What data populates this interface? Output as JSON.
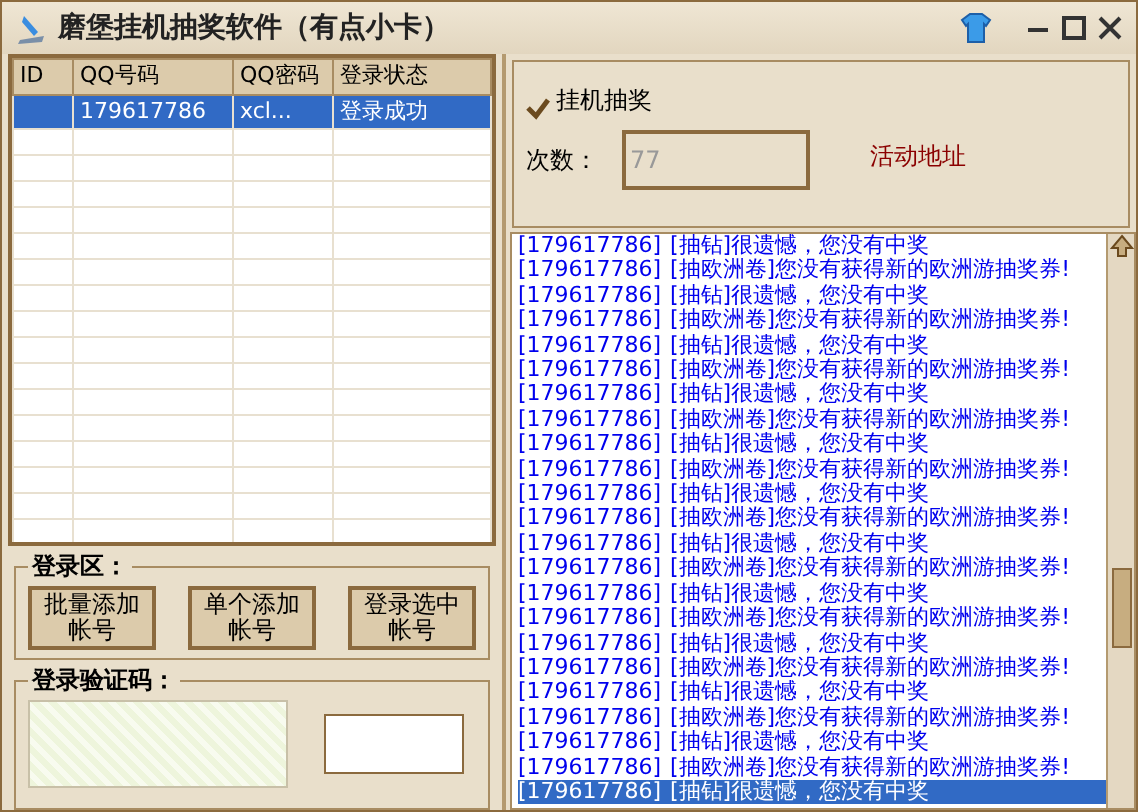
{
  "window": {
    "title": "磨堡挂机抽奖软件（有点小卡）"
  },
  "accounts": {
    "columns": [
      "ID",
      "QQ号码",
      "QQ密码",
      "登录状态"
    ],
    "rows": [
      {
        "qq": "179617786",
        "password": "xcl...",
        "status": "登录成功",
        "selected": true
      }
    ]
  },
  "login_area": {
    "title": "登录区：",
    "buttons": [
      "批量添加帐号",
      "单个添加帐号",
      "登录选中帐号"
    ]
  },
  "captcha": {
    "title": "登录验证码："
  },
  "auto_draw": {
    "label": "挂机抽奖",
    "checked": true
  },
  "count": {
    "label": "次数：",
    "value": "77",
    "disabled": true
  },
  "activity_link": "活动地址",
  "log": [
    {
      "account": "[179617786]",
      "message": "[抽钻]很遗憾，您没有中奖",
      "selected": false
    },
    {
      "account": "[179617786]",
      "message": "[抽欧洲卷]您没有获得新的欧洲游抽奖券!",
      "selected": false
    },
    {
      "account": "[179617786]",
      "message": "[抽钻]很遗憾，您没有中奖",
      "selected": false
    },
    {
      "account": "[179617786]",
      "message": "[抽欧洲卷]您没有获得新的欧洲游抽奖券!",
      "selected": false
    },
    {
      "account": "[179617786]",
      "message": "[抽钻]很遗憾，您没有中奖",
      "selected": false
    },
    {
      "account": "[179617786]",
      "message": "[抽欧洲卷]您没有获得新的欧洲游抽奖券!",
      "selected": false
    },
    {
      "account": "[179617786]",
      "message": "[抽钻]很遗憾，您没有中奖",
      "selected": false
    },
    {
      "account": "[179617786]",
      "message": "[抽欧洲卷]您没有获得新的欧洲游抽奖券!",
      "selected": false
    },
    {
      "account": "[179617786]",
      "message": "[抽钻]很遗憾，您没有中奖",
      "selected": false
    },
    {
      "account": "[179617786]",
      "message": "[抽欧洲卷]您没有获得新的欧洲游抽奖券!",
      "selected": false
    },
    {
      "account": "[179617786]",
      "message": "[抽钻]很遗憾，您没有中奖",
      "selected": false
    },
    {
      "account": "[179617786]",
      "message": "[抽欧洲卷]您没有获得新的欧洲游抽奖券!",
      "selected": false
    },
    {
      "account": "[179617786]",
      "message": "[抽钻]很遗憾，您没有中奖",
      "selected": false
    },
    {
      "account": "[179617786]",
      "message": "[抽欧洲卷]您没有获得新的欧洲游抽奖券!",
      "selected": false
    },
    {
      "account": "[179617786]",
      "message": "[抽钻]很遗憾，您没有中奖",
      "selected": false
    },
    {
      "account": "[179617786]",
      "message": "[抽欧洲卷]您没有获得新的欧洲游抽奖券!",
      "selected": false
    },
    {
      "account": "[179617786]",
      "message": "[抽钻]很遗憾，您没有中奖",
      "selected": false
    },
    {
      "account": "[179617786]",
      "message": "[抽欧洲卷]您没有获得新的欧洲游抽奖券!",
      "selected": false
    },
    {
      "account": "[179617786]",
      "message": "[抽钻]很遗憾，您没有中奖",
      "selected": false
    },
    {
      "account": "[179617786]",
      "message": "[抽欧洲卷]您没有获得新的欧洲游抽奖券!",
      "selected": false
    },
    {
      "account": "[179617786]",
      "message": "[抽钻]很遗憾，您没有中奖",
      "selected": false
    },
    {
      "account": "[179617786]",
      "message": "[抽欧洲卷]您没有获得新的欧洲游抽奖券!",
      "selected": false
    },
    {
      "account": "[179617786]",
      "message": "[抽钻]很遗憾，您没有中奖",
      "selected": true
    }
  ]
}
